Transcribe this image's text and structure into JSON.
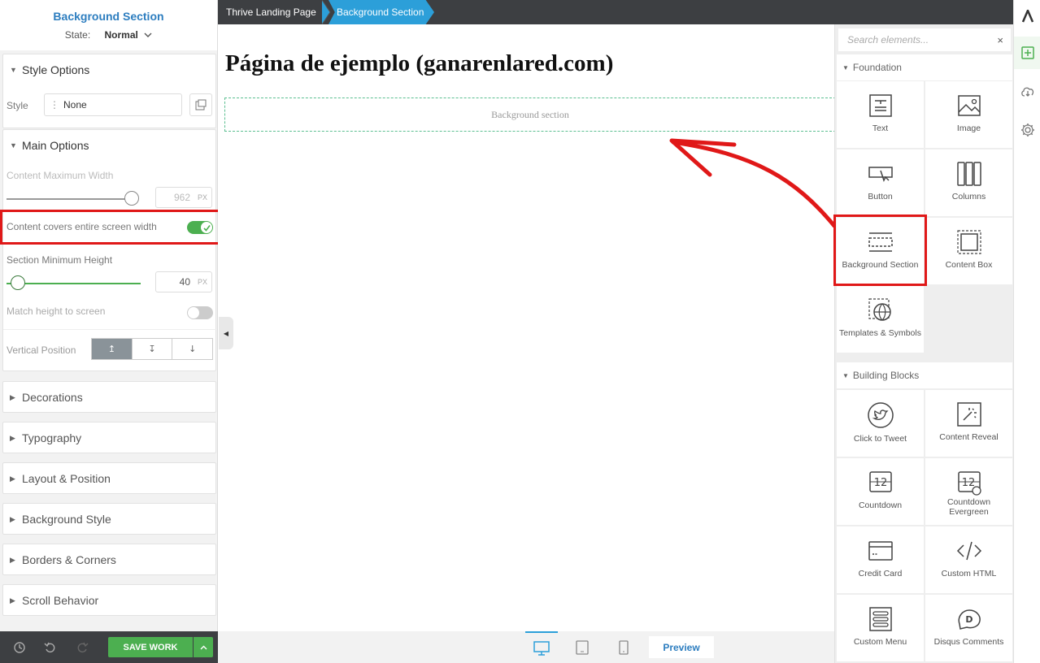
{
  "left_panel": {
    "title": "Background Section",
    "state_label": "State:",
    "state_value": "Normal",
    "style_options": {
      "header": "Style Options",
      "style_label": "Style",
      "style_value": "None"
    },
    "main_options": {
      "header": "Main Options",
      "max_width_label": "Content Maximum Width",
      "max_width_value": "962",
      "max_width_unit": "PX",
      "cover_label": "Content covers entire screen width",
      "cover_on": true,
      "min_height_label": "Section Minimum Height",
      "min_height_value": "40",
      "min_height_unit": "PX",
      "match_height_label": "Match height to screen",
      "match_height_on": false,
      "vertical_position_label": "Vertical Position",
      "vertical_position_options": [
        "↥",
        "↧",
        "↓"
      ]
    },
    "collapsed_sections": [
      "Decorations",
      "Typography",
      "Layout & Position",
      "Background Style",
      "Borders & Corners",
      "Scroll Behavior"
    ],
    "save_label": "SAVE WORK"
  },
  "breadcrumb": [
    "Thrive Landing Page",
    "Background Section"
  ],
  "canvas": {
    "page_title": "Página de ejemplo (ganarenlared.com)",
    "section_placeholder": "Background section"
  },
  "device_bar": {
    "preview_label": "Preview",
    "devices": [
      "desktop-icon",
      "tablet-icon",
      "mobile-icon"
    ]
  },
  "elements_panel": {
    "search_placeholder": "Search elements...",
    "categories": [
      {
        "name": "Foundation",
        "items": [
          "Text",
          "Image",
          "Button",
          "Columns",
          "Background Section",
          "Content Box",
          "Templates & Symbols"
        ]
      },
      {
        "name": "Building Blocks",
        "items": [
          "Click to Tweet",
          "Content Reveal",
          "Countdown",
          "Countdown Evergreen",
          "Credit Card",
          "Custom HTML",
          "Custom Menu",
          "Disqus Comments"
        ]
      }
    ]
  },
  "colors": {
    "accent_blue": "#2c7dbf",
    "save_green": "#4caf50",
    "highlight_red": "#e01818",
    "dark_bar": "#3d3f42"
  }
}
